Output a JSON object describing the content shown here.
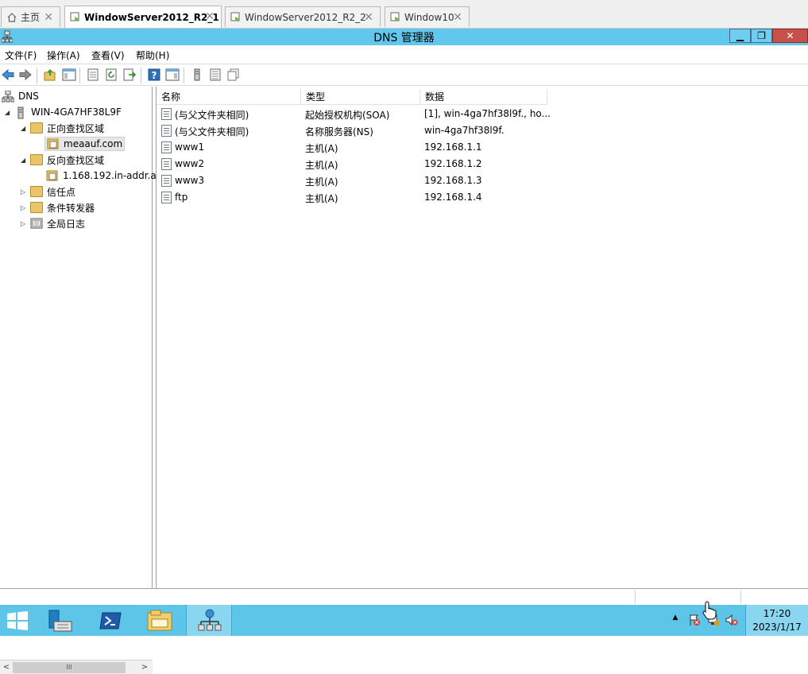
{
  "tabs": [
    {
      "label": "主页",
      "icon": "home-icon"
    },
    {
      "label": "WindowServer2012_R2_1",
      "icon": "vm-icon",
      "active": true
    },
    {
      "label": "WindowServer2012_R2_2",
      "icon": "vm-icon"
    },
    {
      "label": "Window10",
      "icon": "vm-icon"
    }
  ],
  "tab_close": "✕",
  "window": {
    "title": "DNS 管理器",
    "min": "▁",
    "max": "❐",
    "close": "✕"
  },
  "menu": [
    "文件(F)",
    "操作(A)",
    "查看(V)",
    "帮助(H)"
  ],
  "tree": {
    "root": "DNS",
    "server": "WIN-4GA7HF38L9F",
    "forward_zones": "正向查找区域",
    "forward_zone_item": "meaauf.com",
    "reverse_zones": "反向查找区域",
    "reverse_zone_item": "1.168.192.in-addr.a",
    "trust_points": "信任点",
    "conditional_forwarders": "条件转发器",
    "global_logs": "全局日志"
  },
  "list": {
    "columns": [
      "名称",
      "类型",
      "数据"
    ],
    "rows": [
      {
        "name": "(与父文件夹相同)",
        "type": "起始授权机构(SOA)",
        "data": "[1], win-4ga7hf38l9f., ho..."
      },
      {
        "name": "(与父文件夹相同)",
        "type": "名称服务器(NS)",
        "data": "win-4ga7hf38l9f."
      },
      {
        "name": "www1",
        "type": "主机(A)",
        "data": "192.168.1.1"
      },
      {
        "name": "www2",
        "type": "主机(A)",
        "data": "192.168.1.2"
      },
      {
        "name": "www3",
        "type": "主机(A)",
        "data": "192.168.1.3"
      },
      {
        "name": "ftp",
        "type": "主机(A)",
        "data": "192.168.1.4"
      }
    ]
  },
  "scroll": {
    "thumb": "III",
    "left": "<",
    "right": ">"
  },
  "taskbar": {
    "time": "17:20",
    "date": "2023/1/17",
    "tray_up": "▲"
  },
  "colors": {
    "titlebar": "#62c7ed",
    "taskbar": "#5cc5e8",
    "close_button": "#c7504b"
  }
}
